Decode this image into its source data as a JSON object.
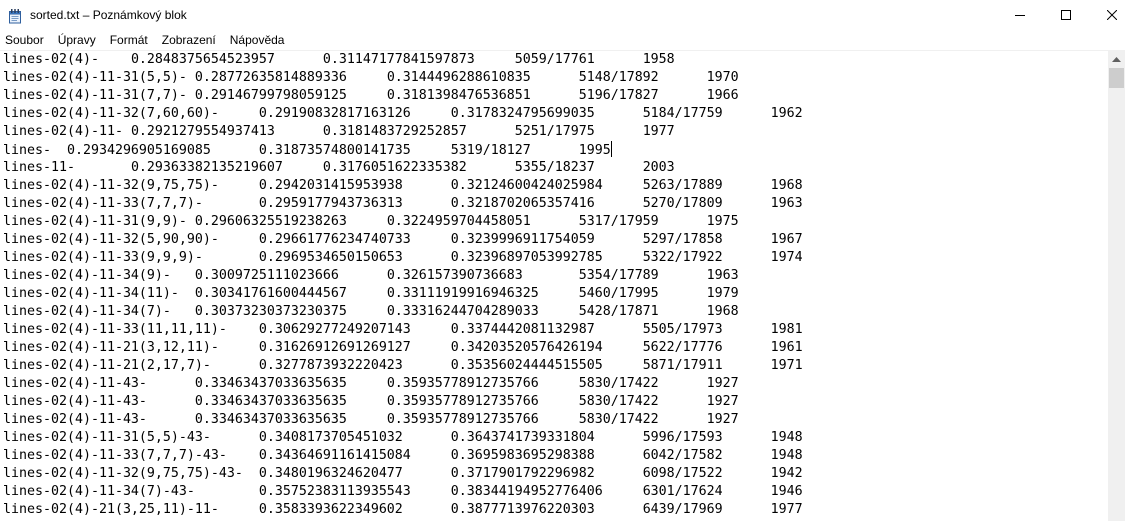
{
  "window": {
    "title": "sorted.txt – Poznámkový blok",
    "app_icon": "notepad-icon",
    "controls": {
      "minimize_icon": "minimize-icon",
      "maximize_icon": "maximize-icon",
      "close_icon": "close-icon"
    }
  },
  "menu": {
    "items": [
      {
        "label": "Soubor"
      },
      {
        "label": "Úpravy"
      },
      {
        "label": "Formát"
      },
      {
        "label": "Zobrazení"
      },
      {
        "label": "Nápověda"
      }
    ]
  },
  "editor": {
    "lines": [
      "lines-02(4)-\t0.2848375654523957\t0.31147177841597873\t5059/17761\t1958",
      "lines-02(4)-11-31(5,5)-\t0.28772635814889336\t0.3144496288610835\t5148/17892\t1970",
      "lines-02(4)-11-31(7,7)-\t0.29146799798059125\t0.3181398476536851\t5196/17827\t1966",
      "lines-02(4)-11-32(7,60,60)-\t0.29190832817163126\t0.3178324795699035\t5184/17759\t1962",
      "lines-02(4)-11-\t0.2921279554937413\t0.3181483729252857\t5251/17975\t1977",
      "lines-\t0.2934296905169085\t0.31873574800141735\t5319/18127\t1995",
      "lines-11-\t0.29363382135219607\t0.3176051622335382\t5355/18237\t2003",
      "lines-02(4)-11-32(9,75,75)-\t0.2942031415953938\t0.32124600424025984\t5263/17889\t1968",
      "lines-02(4)-11-33(7,7,7)-\t0.2959177943736313\t0.3218702065357416\t5270/17809\t1963",
      "lines-02(4)-11-31(9,9)-\t0.29606325519238263\t0.3224959704458051\t5317/17959\t1975",
      "lines-02(4)-11-32(5,90,90)-\t0.29661776234740733\t0.3239996911754059\t5297/17858\t1967",
      "lines-02(4)-11-33(9,9,9)-\t0.2969534650150653\t0.32396897053992785\t5322/17922\t1974",
      "lines-02(4)-11-34(9)-\t0.3009725111023666\t0.326157390736683\t5354/17789\t1963",
      "lines-02(4)-11-34(11)-\t0.30341761600444567\t0.33111919916946325\t5460/17995\t1979",
      "lines-02(4)-11-34(7)-\t0.30373230373230375\t0.33316244704289033\t5428/17871\t1968",
      "lines-02(4)-11-33(11,11,11)-\t0.30629277249207143\t0.3374442081132987\t5505/17973\t1981",
      "lines-02(4)-11-21(3,12,11)-\t0.31626912691269127\t0.34203520576426194\t5622/17776\t1961",
      "lines-02(4)-11-21(2,17,7)-\t0.3277873932220423\t0.35356024444515505\t5871/17911\t1971",
      "lines-02(4)-11-43-\t0.33463437033635635\t0.35935778912735766\t5830/17422\t1927",
      "lines-02(4)-11-43-\t0.33463437033635635\t0.35935778912735766\t5830/17422\t1927",
      "lines-02(4)-11-43-\t0.33463437033635635\t0.35935778912735766\t5830/17422\t1927",
      "lines-02(4)-11-31(5,5)-43-\t0.3408173705451032\t0.3643741739331804\t5996/17593\t1948",
      "lines-02(4)-11-33(7,7,7)-43-\t0.34364691161415084\t0.3695983695298388\t6042/17582\t1948",
      "lines-02(4)-11-32(9,75,75)-43-\t0.3480196324620477\t0.3717901792296982\t6098/17522\t1942",
      "lines-02(4)-11-34(7)-43-\t0.35752383113935543\t0.38344194952776406\t6301/17624\t1946",
      "lines-02(4)-21(3,25,11)-11-\t0.3583393622349602\t0.3877713976220303\t6439/17969\t1977"
    ],
    "caret": {
      "line": 6,
      "column": 62
    }
  },
  "scrollbar": {
    "up_icon": "chevron-up-icon",
    "position": 0
  },
  "colors": {
    "window_bg": "#ffffff",
    "text": "#000000",
    "scroll_track": "#f0f0f0",
    "scroll_thumb": "#cdcdcd"
  }
}
